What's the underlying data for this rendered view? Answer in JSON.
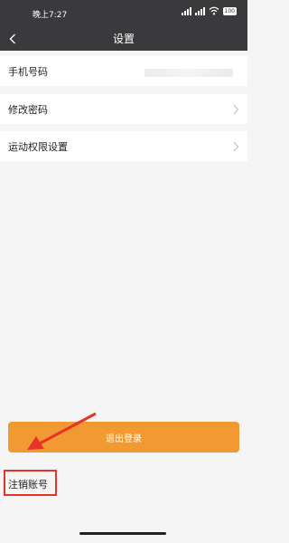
{
  "status_bar": {
    "time": "晚上7:27",
    "battery": "100"
  },
  "navbar": {
    "title": "设置"
  },
  "settings": {
    "items": [
      {
        "label": "手机号码"
      },
      {
        "label": "修改密码"
      },
      {
        "label": "运动权限设置"
      }
    ]
  },
  "logout_button": {
    "label": "退出登录"
  },
  "cancel_account": {
    "label": "注销账号"
  },
  "colors": {
    "header_bg": "#3a3a3c",
    "accent": "#f29a32",
    "annotation": "#e8332a"
  }
}
